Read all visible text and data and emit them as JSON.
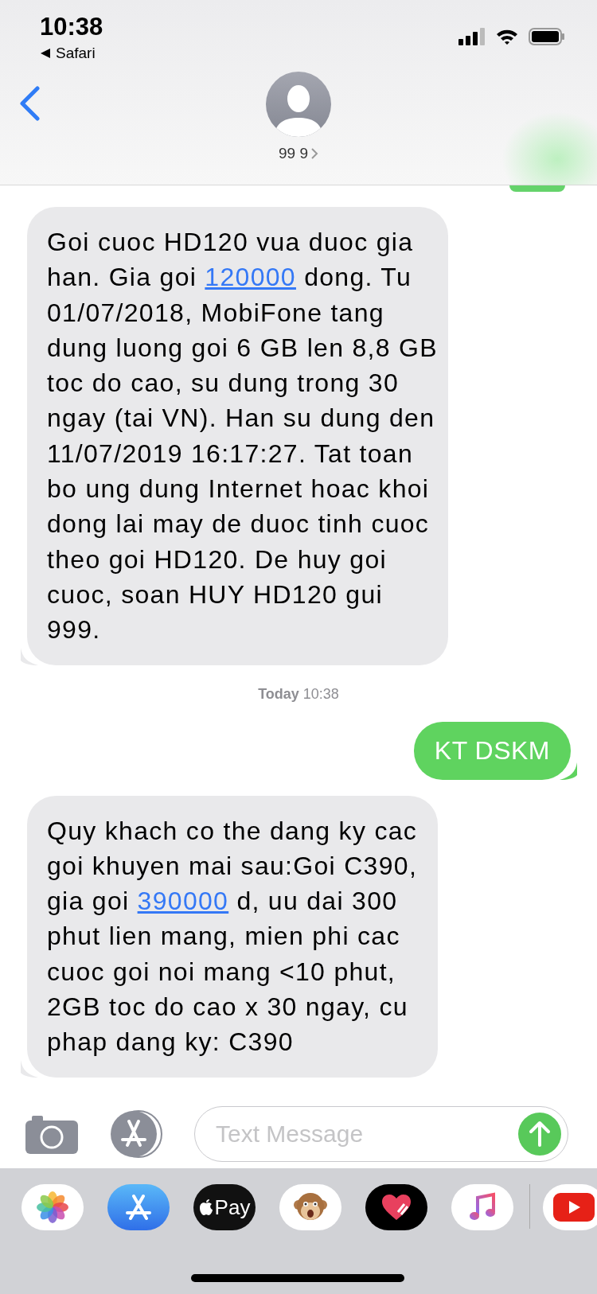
{
  "status_bar": {
    "time": "10:38",
    "back_app": "Safari"
  },
  "header": {
    "contact": "99 9"
  },
  "messages": [
    {
      "kind": "received",
      "parts": [
        {
          "text": "Goi cuoc HD120 vua duoc gia han. Gia goi ",
          "link": false
        },
        {
          "text": "120000",
          "link": true
        },
        {
          "text": " dong. Tu 01/07/2018, MobiFone tang dung luong goi 6 GB len 8,8 GB toc do cao, su dung trong 30 ngay (tai VN). Han su dung den 11/07/2019 16:17:27. Tat toan bo ung dung Internet hoac khoi dong lai may de duoc tinh cuoc theo goi HD120. De huy goi cuoc, soan HUY HD120 gui 999.",
          "link": false
        }
      ]
    },
    {
      "kind": "timestamp",
      "label": "Today",
      "time": "10:38"
    },
    {
      "kind": "sent",
      "parts": [
        {
          "text": "KT DSKM",
          "link": false
        }
      ]
    },
    {
      "kind": "received",
      "parts": [
        {
          "text": "Quy khach co the dang ky cac goi khuyen mai sau:Goi C390, gia goi ",
          "link": false
        },
        {
          "text": "390000",
          "link": true
        },
        {
          "text": " d, uu dai 300 phut lien mang, mien phi cac cuoc goi noi mang <10 phut, 2GB toc do cao x 30 ngay, cu phap dang ky: C390",
          "link": false
        }
      ]
    }
  ],
  "composer": {
    "placeholder": "Text Message"
  },
  "app_drawer": [
    {
      "kind": "photos"
    },
    {
      "kind": "appstore"
    },
    {
      "kind": "pay",
      "label": "Pay"
    },
    {
      "kind": "memoji"
    },
    {
      "kind": "heart"
    },
    {
      "kind": "music"
    },
    {
      "kind": "video"
    }
  ]
}
